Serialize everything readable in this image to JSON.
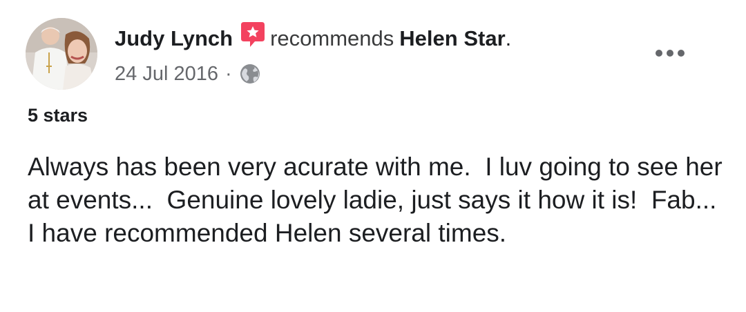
{
  "post": {
    "author": "Judy Lynch",
    "action_verb": "recommends",
    "target_page": "Helen Star",
    "period": ".",
    "date": "24 Jul 2016",
    "separator": "·",
    "privacy_icon": "globe-icon",
    "recommend_icon": "recommend-badge-icon",
    "more_icon": "more-options-icon",
    "rating_label": "5 stars",
    "review_text": "Always has been very acurate with me.  I luv going to see her at events...  Genuine lovely ladie, just says it how it is!  Fab...  I have recommended Helen several times."
  },
  "colors": {
    "text_primary": "#1c1e21",
    "text_secondary": "#65676b",
    "recommend_badge": "#f3425f"
  }
}
